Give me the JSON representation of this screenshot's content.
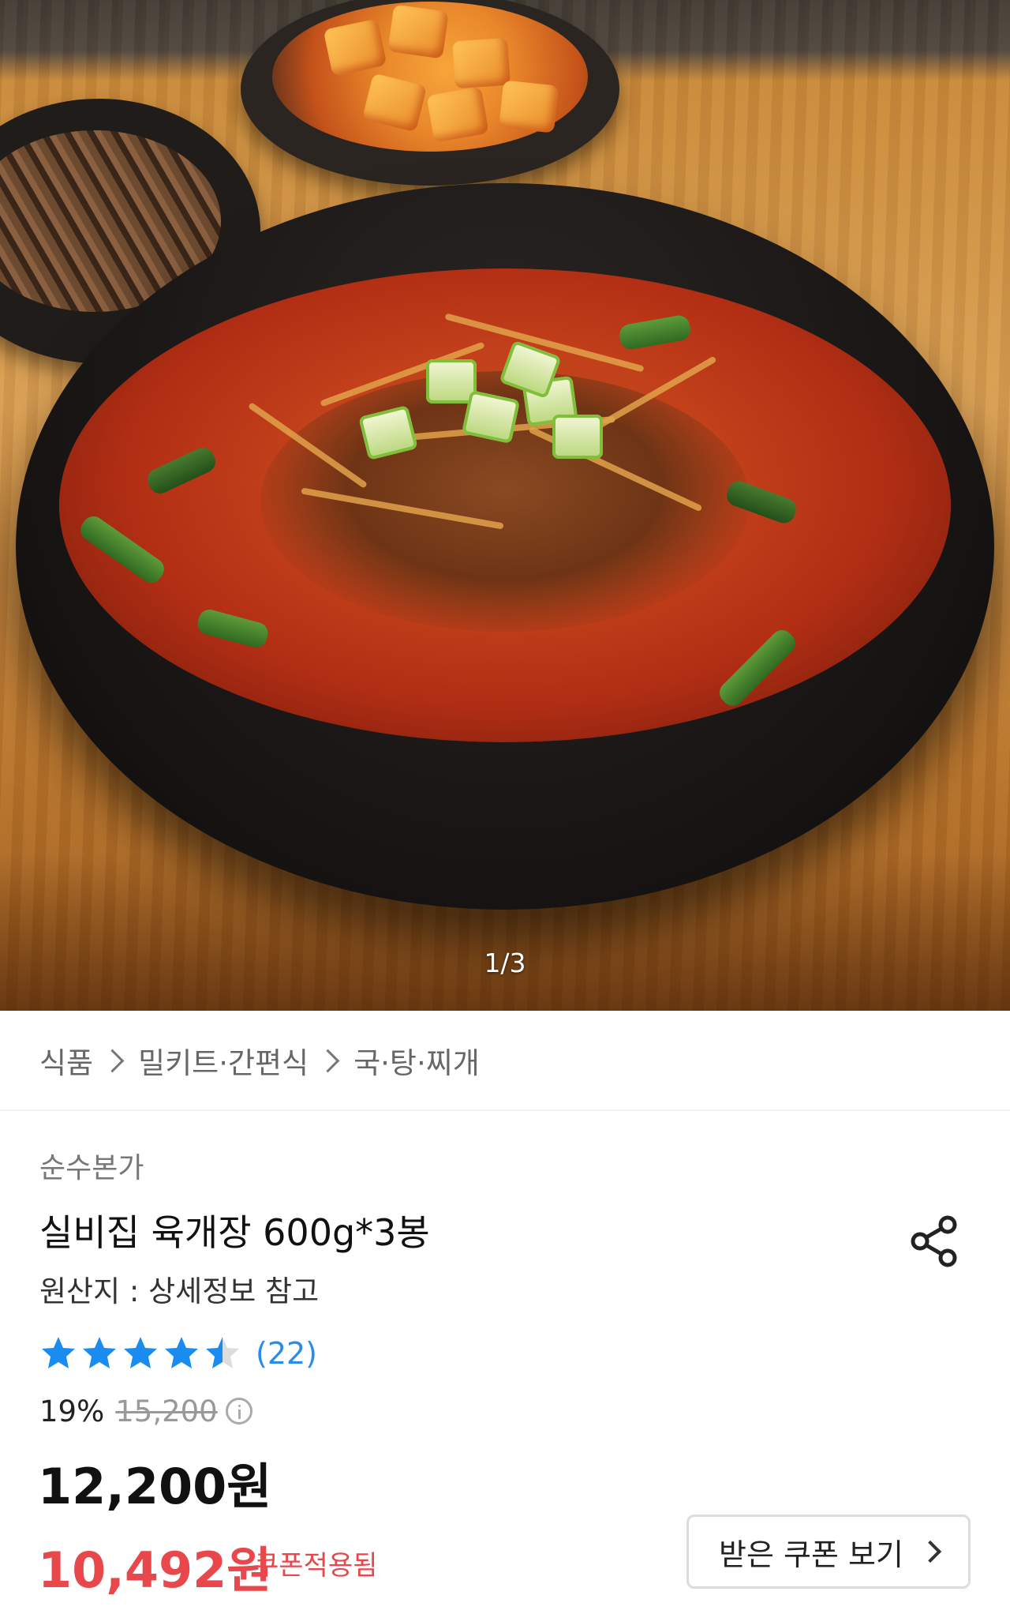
{
  "hero": {
    "image_alt": "육개장",
    "counter": "1/3"
  },
  "breadcrumb": {
    "items": [
      "식품",
      "밀키트·간편식",
      "국·탕·찌개"
    ]
  },
  "product": {
    "brand": "순수본가",
    "title": "실비집 육개장 600g*3봉",
    "origin": "원산지 : 상세정보 참고",
    "rating": 4.5,
    "rating_max": 5,
    "review_count": "(22)",
    "discount_percent": "19%",
    "original_price": "15,200",
    "price": "12,200원",
    "coupon_price": "10,492원",
    "coupon_applied_label": "쿠폰적용됨",
    "coupon_button_label": "받은 쿠폰 보기"
  },
  "colors": {
    "star": "#1a8cf0",
    "review_count": "#2a8be8",
    "coupon_price": "#e8474b"
  },
  "icons": {
    "share": "share-icon",
    "info": "info-icon",
    "breadcrumb_separator": "chevron-right-icon",
    "coupon_arrow": "chevron-right-icon"
  }
}
